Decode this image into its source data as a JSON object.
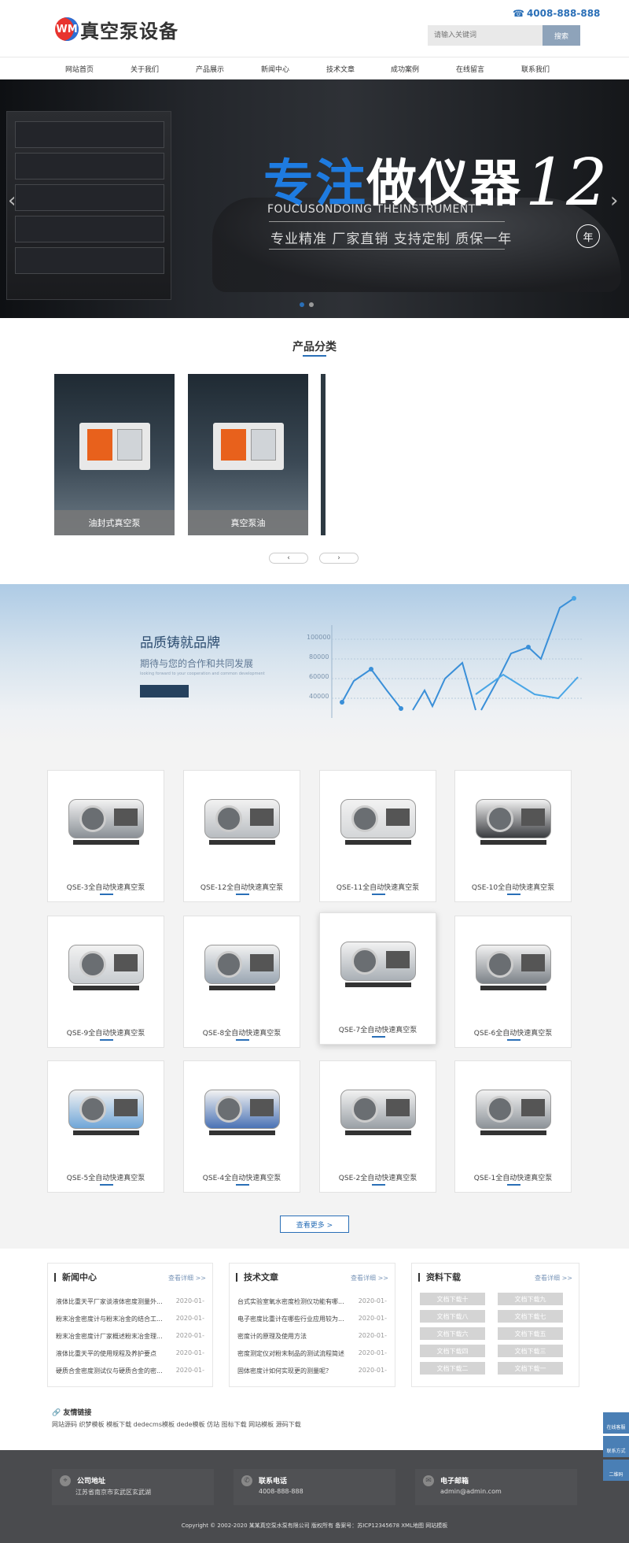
{
  "header": {
    "logo_mark": "WM",
    "logo_text": "真空泵设备",
    "phone": "4008-888-888",
    "search_placeholder": "请输入关键词",
    "search_button": "搜索"
  },
  "nav": [
    "网站首页",
    "关于我们",
    "产品展示",
    "新闻中心",
    "技术文章",
    "成功案例",
    "在线留言",
    "联系我们"
  ],
  "banner": {
    "title_blue": "专注",
    "title_white": "做仪器",
    "number": "12",
    "year_badge": "年",
    "english": "FOUCUSONDOING THEINSTRUMENT",
    "subtitle": "专业精准 厂家直销 支持定制 质保一年",
    "arrow_left": "‹",
    "arrow_right": "›"
  },
  "categories": {
    "title": "产品分类",
    "items": [
      "油封式真空泵",
      "真空泵油"
    ],
    "prev": "‹",
    "next": "›"
  },
  "quality": {
    "title": "品质铸就品牌",
    "subtitle": "期待与您的合作和共同发展",
    "subtitle_en": "looking forward to your cooperation and common development",
    "chart_ticks": [
      "100000",
      "80000",
      "60000",
      "40000"
    ]
  },
  "products": {
    "items": [
      "QSE-3全自动快速真空泵",
      "QSE-12全自动快速真空泵",
      "QSE-11全自动快速真空泵",
      "QSE-10全自动快速真空泵",
      "QSE-9全自动快速真空泵",
      "QSE-8全自动快速真空泵",
      "QSE-7全自动快速真空泵",
      "QSE-6全自动快速真空泵",
      "QSE-5全自动快速真空泵",
      "QSE-4全自动快速真空泵",
      "QSE-2全自动快速真空泵",
      "QSE-1全自动快速真空泵"
    ],
    "more_button": "查看更多 >"
  },
  "news": {
    "title": "新闻中心",
    "more": "查看详细 >>",
    "items": [
      {
        "title": "液体比重天平厂家谈液体密度测量外...",
        "date": "2020-01-"
      },
      {
        "title": "粉末冶金密度计与粉末冶金的结合工...",
        "date": "2020-01-"
      },
      {
        "title": "粉末冶金密度计厂家概述粉末冶金理...",
        "date": "2020-01-"
      },
      {
        "title": "液体比重天平的使用规程及养护要点",
        "date": "2020-01-"
      },
      {
        "title": "硬质合金密度测试仪与硬质合金的密...",
        "date": "2020-01-"
      }
    ]
  },
  "articles": {
    "title": "技术文章",
    "more": "查看详细 >>",
    "items": [
      {
        "title": "台式实验室氧水密度检测仪功能有哪...",
        "date": "2020-01-"
      },
      {
        "title": "电子密度比重计在哪些行业应用较为...",
        "date": "2020-01-"
      },
      {
        "title": "密度计的原理及使用方法",
        "date": "2020-01-"
      },
      {
        "title": "密度测定仪对粉末制品的测试流程简述",
        "date": "2020-01-"
      },
      {
        "title": "固体密度计如何实现更的测量呢？",
        "date": "2020-01-"
      }
    ]
  },
  "downloads": {
    "title": "资料下载",
    "more": "查看详细 >>",
    "items": [
      "文档下载十",
      "文档下载九",
      "文档下载八",
      "文档下载七",
      "文档下载六",
      "文档下载五",
      "文档下载四",
      "文档下载三",
      "文档下载二",
      "文档下载一"
    ]
  },
  "links": {
    "title": "友情链接",
    "items": "网站源码 织梦模板 模板下载 dedecms模板 dede模板 仿站 图标下载 网站模板 源码下载"
  },
  "footer": {
    "address_title": "公司地址",
    "address": "江苏省南京市玄武区玄武湖",
    "phone_title": "联系电话",
    "phone": "4008-888-888",
    "email_title": "电子邮箱",
    "email": "admin@admin.com",
    "copyright": "Copyright © 2002-2020 某某真空泵水泵有限公司 版权所有 备案号：苏ICP12345678 XML地图 网站模板"
  },
  "side_float": [
    "在线客服",
    "联系方式",
    "二维码"
  ],
  "colors": {
    "accent": "#2a6fb7",
    "banner_blue": "#1e7be0",
    "footer_bg": "#4a4b4e"
  }
}
